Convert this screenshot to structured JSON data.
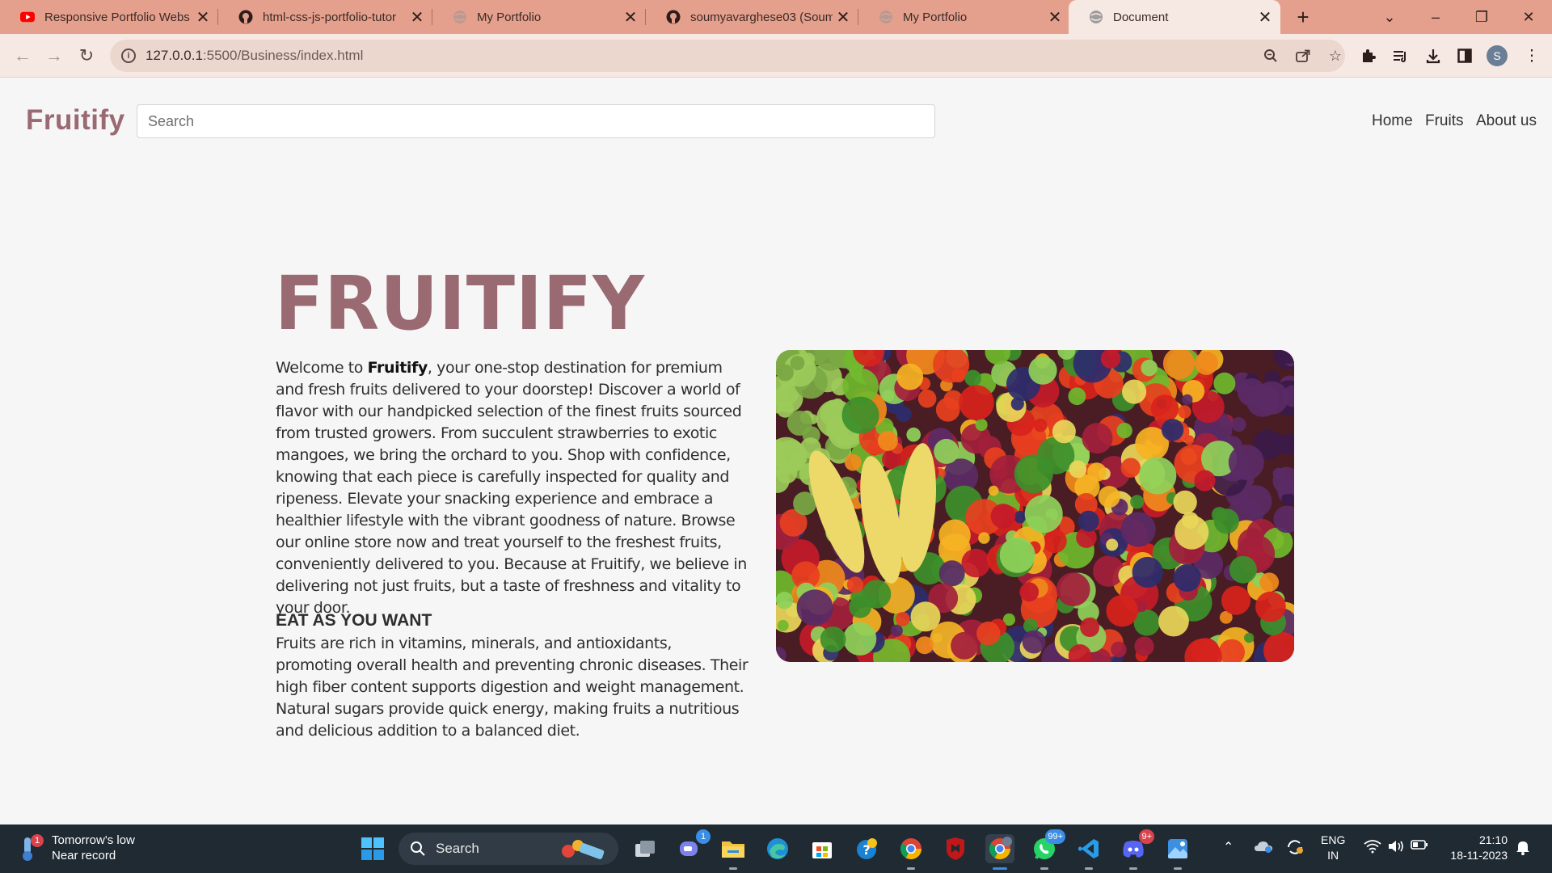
{
  "browser": {
    "tabs": [
      {
        "title": "Responsive Portfolio Webs",
        "icon": "youtube-icon"
      },
      {
        "title": "html-css-js-portfolio-tutor",
        "icon": "github-icon"
      },
      {
        "title": "My Portfolio",
        "icon": "globe-icon"
      },
      {
        "title": "soumyavarghese03 (Soumy",
        "icon": "github-icon"
      },
      {
        "title": "My Portfolio",
        "icon": "globe-icon"
      },
      {
        "title": "Document",
        "icon": "globe-icon"
      }
    ],
    "url_host": "127.0.0.1",
    "url_rest": ":5500/Business/index.html",
    "profile_initial": "S"
  },
  "site": {
    "brand": "Fruitify",
    "search_placeholder": "Search",
    "nav": [
      "Home",
      "Fruits",
      "About us"
    ]
  },
  "hero": {
    "title": "FRUITIFY",
    "para1_prefix": "Welcome to ",
    "para1_bold": "Fruitify",
    "para1_rest": ", your one-stop destination for premium and fresh fruits delivered to your doorstep! Discover a world of flavor with our handpicked selection of the finest fruits sourced from trusted growers. From succulent strawberries to exotic mangoes, we bring the orchard to you. Shop with confidence, knowing that each piece is carefully inspected for quality and ripeness. Elevate your snacking experience and embrace a healthier lifestyle with the vibrant goodness of nature. Browse our online store now and treat yourself to the freshest fruits, conveniently delivered to you. Because at Fruitify, we believe in delivering not just fruits, but a taste of freshness and vitality to your door.",
    "subheading": "EAT AS YOU WANT",
    "para2": "Fruits are rich in vitamins, minerals, and antioxidants, promoting overall health and preventing chronic diseases. Their high fiber content supports digestion and weight management. Natural sugars provide quick energy, making fruits a nutritious and delicious addition to a balanced diet."
  },
  "taskbar": {
    "weather_line1": "Tomorrow's low",
    "weather_line2": "Near record",
    "weather_badge": "1",
    "search_label": "Search",
    "teams_badge": "1",
    "whatsapp_badge": "99+",
    "discord_badge": "9+",
    "lang_line1": "ENG",
    "lang_line2": "IN",
    "time": "21:10",
    "date": "18-11-2023"
  },
  "colors": {
    "tab_strip": "#e4a08d",
    "active_tab": "#f6e9e4",
    "brand": "#9a6a73",
    "taskbar": "#1f2a33"
  }
}
